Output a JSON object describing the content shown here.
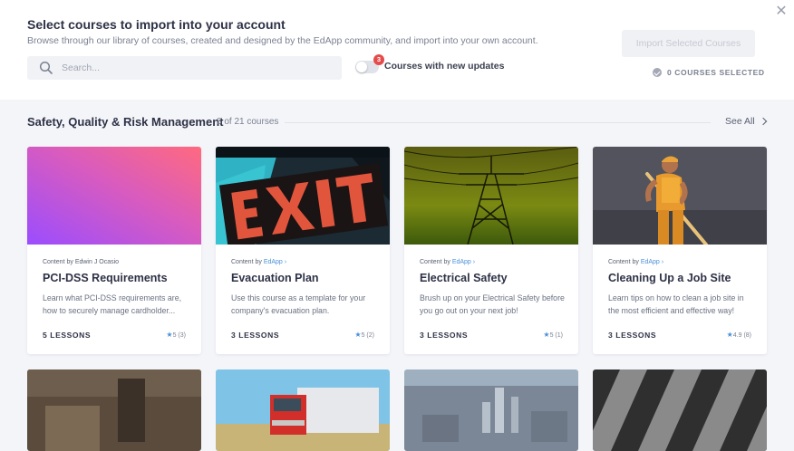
{
  "header": {
    "title": "Select courses to import into your account",
    "subtitle": "Browse through our library of courses, created and designed by the EdApp community, and import into your own account.",
    "search_placeholder": "Search...",
    "toggle_label": "Courses with new updates",
    "updates_badge": "3",
    "import_button": "Import Selected Courses",
    "selected_status": "0 COURSES SELECTED"
  },
  "section": {
    "title": "Safety, Quality & Risk Management",
    "count": "8 of 21 courses",
    "see_all": "See All"
  },
  "courses": [
    {
      "content_by_prefix": "Content by ",
      "author": "Edwin J Ocasio",
      "author_is_link": false,
      "title": "PCI-DSS Requirements",
      "desc": "Learn what PCI-DSS requirements are, how to securely manage cardholder...",
      "lessons": "5 LESSONS",
      "rating": "5 (3)",
      "thumb_icon": "gradient-thumbnail"
    },
    {
      "content_by_prefix": "Content by ",
      "author": "EdApp",
      "author_is_link": true,
      "title": "Evacuation Plan",
      "desc": "Use this course as a template for your company's evacuation plan.",
      "lessons": "3 LESSONS",
      "rating": "5 (2)",
      "thumb_icon": "exit-sign-thumbnail"
    },
    {
      "content_by_prefix": "Content by ",
      "author": "EdApp",
      "author_is_link": true,
      "title": "Electrical Safety",
      "desc": "Brush up on your Electrical Safety before you go out on your next job!",
      "lessons": "3 LESSONS",
      "rating": "5 (1)",
      "thumb_icon": "power-lines-thumbnail"
    },
    {
      "content_by_prefix": "Content by ",
      "author": "EdApp",
      "author_is_link": true,
      "title": "Cleaning Up a Job Site",
      "desc": "Learn tips on how to clean a job site in the most efficient and effective way!",
      "lessons": "3 LESSONS",
      "rating": "4.9 (8)",
      "thumb_icon": "worker-thumbnail"
    }
  ],
  "colors": {
    "accent_link": "#4a90d9",
    "badge": "#e54b4b",
    "title_text": "#2e3246",
    "page_bg": "#f4f5f9"
  }
}
